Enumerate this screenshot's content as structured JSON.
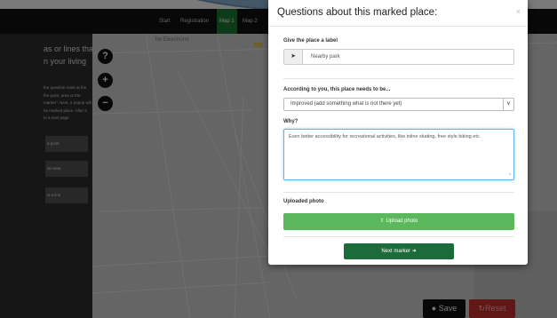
{
  "nav": {
    "links": [
      "Start",
      "Registration",
      "Map 1",
      "Map 2"
    ],
    "active_index": 2
  },
  "sidebar": {
    "heading_line1": "as or lines that",
    "heading_line2": "n your living",
    "instructions": [
      "the question mark at the",
      "the point, area or the",
      "marker\". Next, a popup will",
      "he marked place. After 3",
      "to a next page"
    ],
    "buttons": [
      "a point",
      "an area",
      "w a line"
    ]
  },
  "map": {
    "label": "Ter Eikenhorst",
    "help_icon": "question-icon",
    "zoom_in_icon": "plus-icon",
    "zoom_out_icon": "minus-icon"
  },
  "actions": {
    "save_label": "Save",
    "reset_label": "Reset",
    "save_icon": "map-pin-icon",
    "reset_icon": "undo-icon"
  },
  "modal": {
    "title": "Questions about this marked place:",
    "close_label": "×",
    "label_field": {
      "label": "Give the place a label",
      "value": "Nearby park",
      "icon": "pin-icon"
    },
    "needs_field": {
      "label": "According to you, this place needs to be...",
      "selected": "Improved (add something what is not there yet)",
      "arrow": "∨"
    },
    "why_field": {
      "label": "Why?",
      "value": "Even better accessibility for recreational activities, like inline skating, free style biking etc."
    },
    "photo": {
      "label": "Uploaded photo",
      "button_label": "Upload photo",
      "icon": "upload-icon"
    },
    "next_button": {
      "label": "Next marker",
      "icon": "arrow-right-icon"
    }
  },
  "colors": {
    "nav_active": "#1f7a34",
    "upload_button": "#5cb85c",
    "next_button": "#1c6b3a",
    "reset_button": "#c9302c",
    "bubble": "#8fb7d8"
  }
}
